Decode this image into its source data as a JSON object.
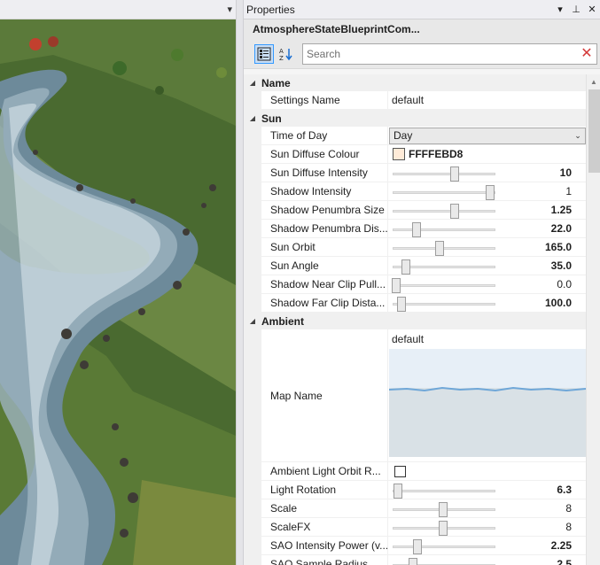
{
  "viewport": {
    "menu_glyph": "▾"
  },
  "panel": {
    "title": "Properties",
    "btn_dropdown": "▾",
    "btn_pin": "⊥",
    "btn_close": "✕",
    "object_name": "AtmosphereStateBlueprintCom...",
    "search_placeholder": "Search",
    "search_clear": "✕"
  },
  "categories": {
    "name": {
      "label": "Name"
    },
    "sun": {
      "label": "Sun"
    },
    "ambient": {
      "label": "Ambient"
    }
  },
  "props": {
    "settings_name": {
      "label": "Settings Name",
      "value": "default"
    },
    "time_of_day": {
      "label": "Time of Day",
      "value": "Day"
    },
    "sun_diffuse_colour": {
      "label": "Sun Diffuse Colour",
      "value": "FFFFEBD8",
      "swatch": "#ffebd8"
    },
    "sun_diffuse_intensity": {
      "label": "Sun Diffuse Intensity",
      "value": "10",
      "fill": 0.62
    },
    "shadow_intensity": {
      "label": "Shadow Intensity",
      "value": "1",
      "fill": 1.0
    },
    "shadow_penumbra_size": {
      "label": "Shadow Penumbra Size",
      "value": "1.25",
      "fill": 0.62
    },
    "shadow_penumbra_dis": {
      "label": "Shadow Penumbra Dis...",
      "value": "22.0",
      "fill": 0.22
    },
    "sun_orbit": {
      "label": "Sun Orbit",
      "value": "165.0",
      "fill": 0.46
    },
    "sun_angle": {
      "label": "Sun Angle",
      "value": "35.0",
      "fill": 0.1
    },
    "shadow_near_clip": {
      "label": "Shadow Near Clip Pull...",
      "value": "0.0",
      "fill": 0.0
    },
    "shadow_far_clip": {
      "label": "Shadow Far Clip Dista...",
      "value": "100.0",
      "fill": 0.06
    },
    "map_name": {
      "label": "Map Name",
      "value": "default"
    },
    "ambient_light_orbit": {
      "label": "Ambient Light Orbit R..."
    },
    "light_rotation": {
      "label": "Light Rotation",
      "value": "6.3",
      "fill": 0.02
    },
    "scale": {
      "label": "Scale",
      "value": "8",
      "fill": 0.5
    },
    "scalefx": {
      "label": "ScaleFX",
      "value": "8",
      "fill": 0.5
    },
    "sao_intensity_power": {
      "label": "SAO Intensity Power (v...",
      "value": "2.25",
      "fill": 0.23
    },
    "sao_sample_radius": {
      "label": "SAO Sample Radius",
      "value": "2.5",
      "fill": 0.18
    }
  }
}
